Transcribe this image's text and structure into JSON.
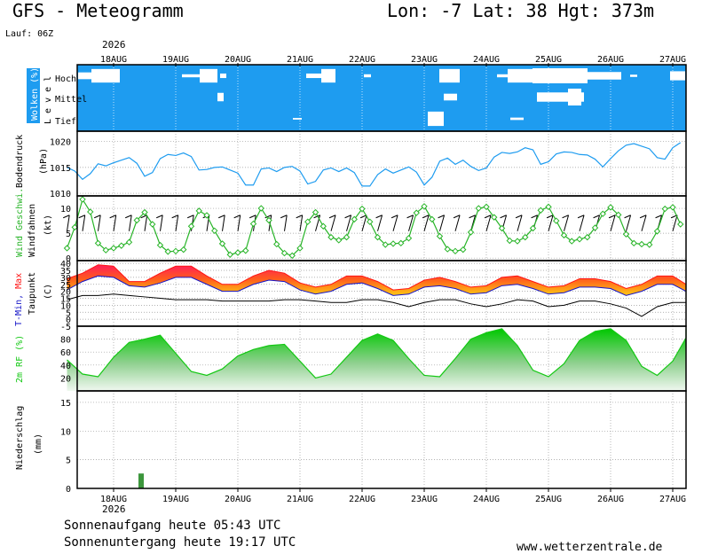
{
  "header": {
    "title": "GFS - Meteogramm",
    "location": "Lon: -7 Lat: 38 Hgt: 373m",
    "run": "Lauf: 06Z"
  },
  "footer": {
    "year": "2026",
    "sunrise": "Sonnenaufgang heute 05:43 UTC",
    "sunset": "Sonnenuntergang heute 19:17 UTC",
    "website": "www.wetterzentrale.de"
  },
  "dates": [
    "18AUG",
    "19AUG",
    "20AUG",
    "21AUG",
    "22AUG",
    "23AUG",
    "24AUG",
    "25AUG",
    "26AUG",
    "27AUG"
  ],
  "colors": {
    "cloud_bg": "#1e9cf0",
    "pressure": "#1e9cf0",
    "wind": "#28b428",
    "humidity": "#14c814",
    "rain": "#3c963c",
    "tmax": "#ff1414",
    "tmin": "#1414c8"
  },
  "chart_data": [
    {
      "type": "heatmap",
      "panel": "clouds",
      "ylabel": "Wolken (%)",
      "level_label": "L e v e l",
      "categories": [
        "Hoch",
        "Mittel",
        "Tief"
      ]
    },
    {
      "type": "line",
      "panel": "pressure",
      "ylabel": "Bodendruck",
      "unit": "(hPa)",
      "yticks": [
        1010,
        1015,
        1020
      ],
      "ylim": [
        1009.5,
        1022
      ],
      "x_start": "2026-08-17T06:00Z",
      "x_step_hours": 3,
      "values": [
        1015.0,
        1014.3,
        1012.7,
        1013.8,
        1015.7,
        1015.3,
        1015.9,
        1016.4,
        1016.9,
        1015.8,
        1013.3,
        1014.0,
        1016.7,
        1017.5,
        1017.3,
        1017.8,
        1017.1,
        1014.5,
        1014.6,
        1015.0,
        1015.1,
        1014.5,
        1013.9,
        1011.6,
        1011.6,
        1014.7,
        1014.9,
        1014.2,
        1015.0,
        1015.2,
        1014.3,
        1011.8,
        1012.3,
        1014.5,
        1014.9,
        1014.2,
        1014.9,
        1014.0,
        1011.4,
        1011.4,
        1013.6,
        1014.7,
        1013.9,
        1014.5,
        1015.1,
        1014.1,
        1011.6,
        1013.1,
        1016.2,
        1016.8,
        1015.6,
        1016.4,
        1015.2,
        1014.4,
        1014.9,
        1017.0,
        1017.9,
        1017.7,
        1018.0,
        1018.8,
        1018.4,
        1015.6,
        1016.1,
        1017.6,
        1018.0,
        1017.9,
        1017.5,
        1017.4,
        1016.6,
        1015.1,
        1016.7,
        1018.2,
        1019.3,
        1019.6,
        1019.1,
        1018.6,
        1016.9,
        1016.6,
        1018.8,
        1019.8,
        1019.4
      ]
    },
    {
      "type": "line",
      "panel": "wind",
      "ylabel": "Wind Geschwi.",
      "ylabel2": "Windfahnen",
      "unit": "(kt)",
      "yticks": [
        0,
        5,
        10
      ],
      "ylim": [
        -0.5,
        12.5
      ],
      "x_start": "2026-08-17T06:00Z",
      "x_step_hours": 3,
      "values": [
        2.0,
        6.2,
        11.8,
        9.3,
        3.0,
        1.6,
        2.0,
        2.5,
        3.2,
        7.6,
        9.2,
        6.8,
        2.6,
        1.3,
        1.4,
        1.7,
        6.4,
        9.5,
        8.6,
        5.5,
        2.9,
        0.7,
        1.1,
        1.5,
        6.9,
        10.0,
        7.6,
        2.8,
        1.0,
        0.5,
        2.0,
        7.3,
        9.2,
        6.4,
        4.2,
        3.6,
        4.2,
        7.8,
        9.9,
        7.3,
        4.2,
        2.7,
        2.9,
        3.0,
        4.0,
        9.1,
        10.4,
        7.8,
        4.4,
        1.8,
        1.4,
        1.7,
        5.2,
        10.0,
        10.3,
        8.2,
        6.0,
        3.5,
        3.4,
        4.2,
        6.0,
        9.6,
        10.3,
        7.5,
        4.6,
        3.4,
        3.8,
        4.2,
        6.1,
        8.9,
        10.2,
        8.7,
        4.8,
        3.0,
        2.8,
        2.7,
        5.4,
        9.9,
        10.2,
        6.8,
        3.5
      ]
    },
    {
      "type": "area",
      "panel": "temperature",
      "ylabel_parts": [
        "T-Min,",
        " Max"
      ],
      "ylabel2": "Taupunkt",
      "unit": "(C)",
      "yticks": [
        -5,
        0,
        5,
        10,
        15,
        20,
        25,
        30,
        35,
        40
      ],
      "ylim": [
        -5,
        42
      ],
      "x_start": "2026-08-17T06:00Z",
      "x_step_hours": 6,
      "tmax": [
        29,
        33,
        39,
        38,
        27,
        27,
        33,
        38,
        38,
        31,
        25,
        25,
        31,
        35,
        33,
        26,
        23,
        25,
        31,
        31,
        27,
        21,
        22,
        28,
        30,
        27,
        23,
        24,
        30,
        31,
        27,
        23,
        24,
        29,
        29,
        27,
        22,
        25,
        31,
        31,
        25,
        22
      ],
      "tmin": [
        21,
        27,
        31,
        30,
        24,
        23,
        26,
        30,
        30,
        25,
        20,
        20,
        25,
        28,
        27,
        21,
        18,
        20,
        25,
        26,
        22,
        17,
        18,
        23,
        24,
        22,
        18,
        19,
        24,
        25,
        22,
        18,
        19,
        23,
        23,
        22,
        17,
        20,
        25,
        25,
        20,
        17
      ],
      "dewpoint": [
        14,
        17,
        17,
        18,
        17,
        16,
        15,
        14,
        14,
        14,
        13,
        13,
        13,
        13,
        14,
        14,
        13,
        12,
        12,
        14,
        14,
        12,
        9,
        12,
        14,
        14,
        11,
        9,
        11,
        14,
        13,
        9,
        10,
        13,
        13,
        11,
        8,
        2,
        9,
        12,
        12,
        14
      ]
    },
    {
      "type": "area",
      "panel": "humidity",
      "ylabel": "2m RF (%)",
      "yticks": [
        20,
        40,
        60,
        80
      ],
      "ylim": [
        0,
        100
      ],
      "x_start": "2026-08-17T06:00Z",
      "x_step_hours": 6,
      "values": [
        48,
        26,
        22,
        52,
        75,
        80,
        86,
        58,
        30,
        24,
        34,
        54,
        64,
        70,
        72,
        46,
        20,
        26,
        52,
        78,
        88,
        78,
        50,
        24,
        22,
        50,
        80,
        90,
        96,
        70,
        32,
        22,
        42,
        78,
        92,
        96,
        78,
        38,
        24,
        46,
        82,
        96
      ]
    },
    {
      "type": "bar",
      "panel": "precipitation",
      "ylabel": "Niederschlag",
      "unit": "(mm)",
      "yticks": [
        0,
        5,
        10,
        15
      ],
      "ylim": [
        0,
        17
      ],
      "x_start": "2026-08-17T06:00Z",
      "x_step_hours": 6,
      "values": [
        0,
        0,
        0,
        0,
        0,
        2.6,
        0,
        0,
        0,
        0,
        0,
        0,
        0,
        0,
        0,
        0,
        0,
        0,
        0,
        0,
        0,
        0,
        0,
        0,
        0,
        0,
        0,
        0,
        0,
        0,
        0,
        0,
        0,
        0,
        0,
        0,
        0,
        0,
        0,
        0,
        0,
        0
      ]
    }
  ]
}
